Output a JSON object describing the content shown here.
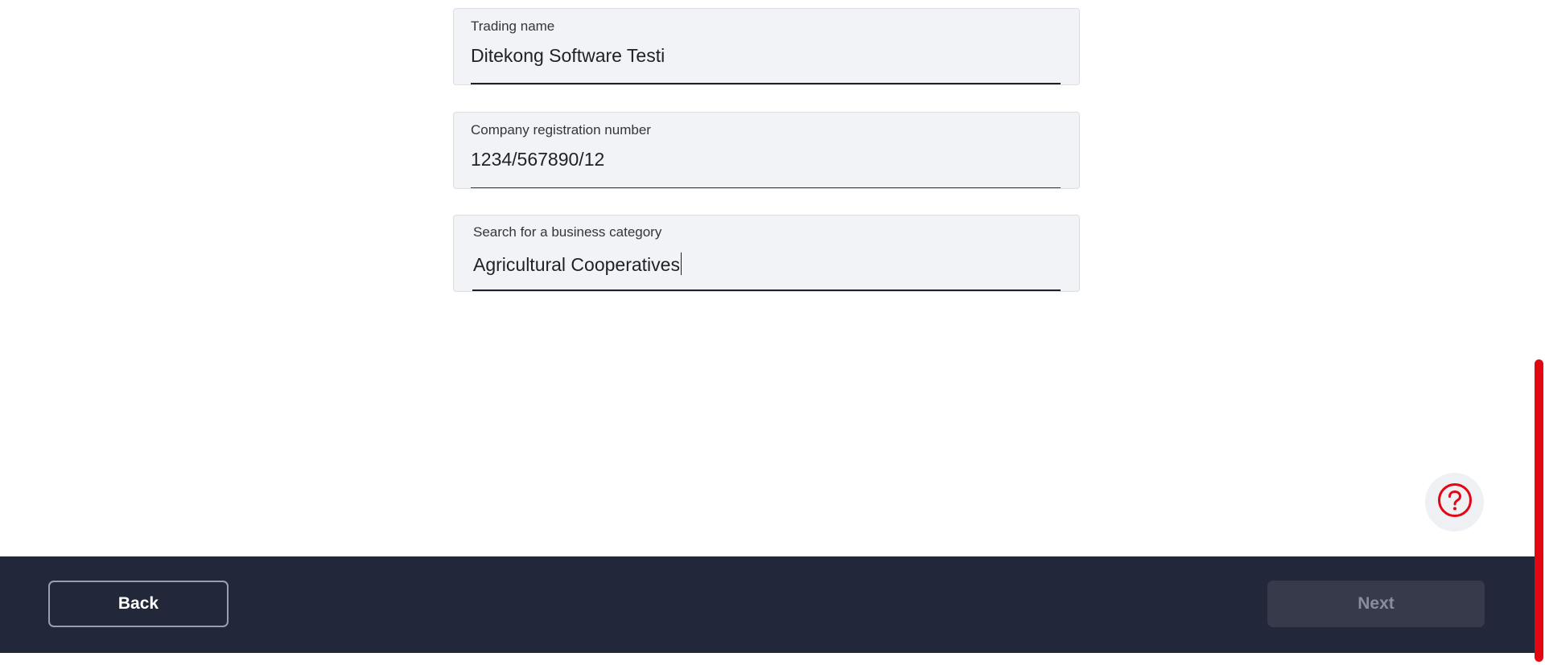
{
  "form": {
    "fields": [
      {
        "label": "Trading name",
        "value": "Ditekong Software Testi"
      },
      {
        "label": "Company registration number",
        "value": "1234/567890/12"
      },
      {
        "label": "Search for a business category",
        "value": "Agricultural Cooperatives"
      }
    ]
  },
  "help": {
    "icon": "question-circle-icon",
    "color": "#e30613"
  },
  "footer": {
    "back_label": "Back",
    "next_label": "Next",
    "background": "#22283a"
  },
  "scrollbar": {
    "thumb_color": "#e30613"
  }
}
